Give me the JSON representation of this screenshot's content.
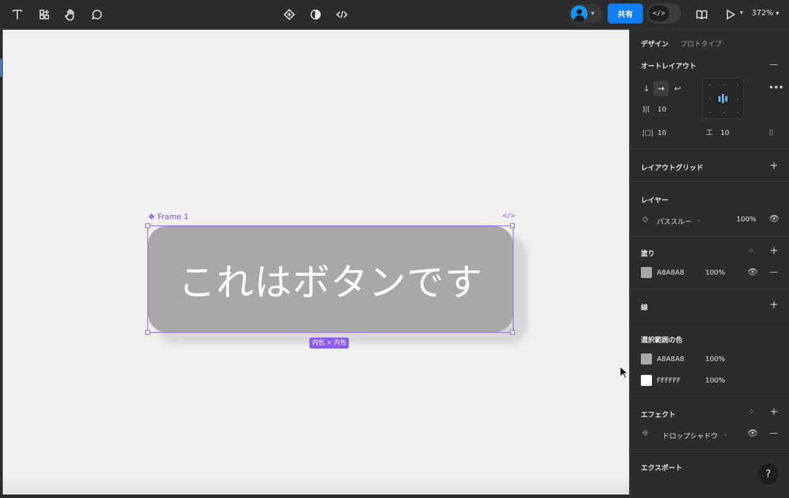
{
  "toolbar": {
    "tools": [
      "text-tool",
      "components-tool",
      "hand-tool",
      "comment-tool"
    ],
    "center_tools": [
      "component-tool",
      "mask-tool",
      "code-tool"
    ],
    "share_label": "共有",
    "devmode_label": "</>",
    "zoom_label": "372%"
  },
  "canvas": {
    "frame_label": "Frame 1",
    "code_tag": "</>",
    "button_text": "これはボタンです",
    "button_color": "#A8A8A8",
    "size_badge": "内包 × 内包",
    "selection_color": "#8A5CF0"
  },
  "panel": {
    "tabs": {
      "design": "デザイン",
      "prototype": "プロトタイプ"
    },
    "auto_layout": {
      "title": "オートレイアウト",
      "gap": "10",
      "padding_h": "10",
      "padding_v": "10"
    },
    "layout_grid": {
      "title": "レイアウトグリッド"
    },
    "layer": {
      "title": "レイヤー",
      "blend": "パススルー",
      "opacity": "100%"
    },
    "fill": {
      "title": "塗り",
      "hex": "A8A8A8",
      "opacity": "100%",
      "color": "#A8A8A8"
    },
    "stroke": {
      "title": "線"
    },
    "selection_colors": {
      "title": "選択範囲の色",
      "items": [
        {
          "hex": "A8A8A8",
          "opacity": "100%",
          "color": "#A8A8A8"
        },
        {
          "hex": "FFFFFF",
          "opacity": "100%",
          "color": "#FFFFFF"
        }
      ]
    },
    "effects": {
      "title": "エフェクト",
      "effect": "ドロップシャドウ"
    },
    "export": {
      "title": "エクスポート"
    }
  },
  "help_label": "?"
}
